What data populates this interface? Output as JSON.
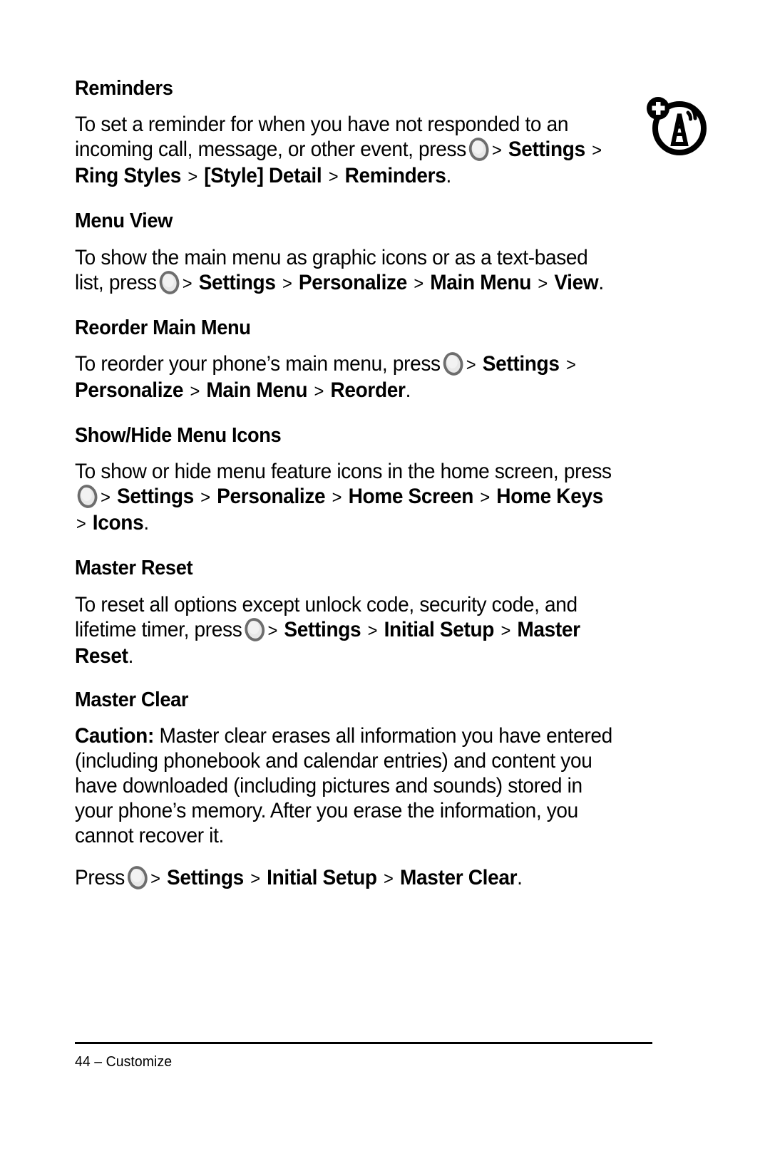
{
  "page": {
    "number": "44",
    "footer_text": "44 – Customize",
    "chapter": "Customize",
    "separator": "–"
  },
  "key_glyph": {
    "name": "center-select-key",
    "fill_color": "#e8e8e8",
    "ring_color": "#6d6d6d"
  },
  "gt": ">",
  "margin_icon": {
    "name": "broadcast-tower-add-icon",
    "color": "#000000"
  },
  "sections": [
    {
      "id": "reminders",
      "heading": "Reminders",
      "body": {
        "lead": "To set a reminder for when you have not responded to an incoming call, message, or other event, press",
        "path": [
          "Settings",
          "Ring Styles",
          "[Style] Detail",
          "Reminders"
        ],
        "trailing": "."
      }
    },
    {
      "id": "menu-view",
      "heading": "Menu View",
      "body": {
        "lead": "To show the main menu as graphic icons or as a text-based list, press",
        "path": [
          "Settings",
          "Personalize",
          "Main Menu",
          "View"
        ],
        "trailing": "."
      }
    },
    {
      "id": "reorder-main-menu",
      "heading": "Reorder Main Menu",
      "body": {
        "lead": "To reorder your phone’s main menu, press",
        "path": [
          "Settings",
          "Personalize",
          "Main Menu",
          "Reorder"
        ],
        "trailing": "."
      }
    },
    {
      "id": "show-hide-menu-icons",
      "heading": "Show/Hide Menu Icons",
      "body": {
        "lead": "To show or hide menu feature icons in the home screen, press",
        "path": [
          "Settings",
          "Personalize",
          "Home Screen",
          "Home Keys",
          "Icons"
        ],
        "trailing": "."
      }
    },
    {
      "id": "master-reset",
      "heading": "Master Reset",
      "body": {
        "lead": "To reset all options except unlock code, security code, and lifetime timer, press",
        "path": [
          "Settings",
          "Initial Setup",
          "Master Reset"
        ],
        "trailing": "."
      }
    },
    {
      "id": "master-clear",
      "heading": "Master Clear",
      "caution_label": "Caution:",
      "caution_text": "Master clear erases all information you have entered (including phonebook and calendar entries) and content you have downloaded (including pictures and sounds) stored in your phone’s memory. After you erase the information, you cannot recover it.",
      "body": {
        "lead": "Press",
        "path": [
          "Settings",
          "Initial Setup",
          "Master Clear"
        ],
        "trailing": "."
      }
    }
  ]
}
